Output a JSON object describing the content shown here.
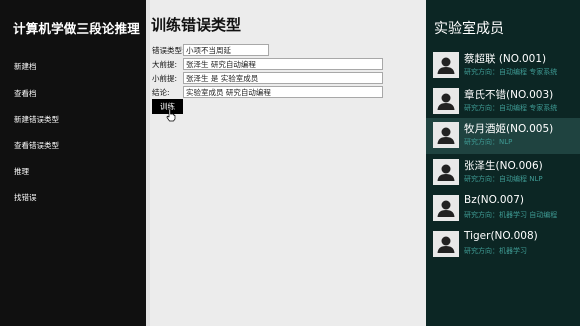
{
  "sidebar": {
    "app_title": "计算机学做三段论推理",
    "items": [
      {
        "label": "新建档"
      },
      {
        "label": "查看档"
      },
      {
        "label": "新建错误类型"
      },
      {
        "label": "查看错误类型"
      },
      {
        "label": "推理"
      },
      {
        "label": "找错误"
      }
    ]
  },
  "main": {
    "title": "训练错误类型",
    "fields": [
      {
        "label": "错误类型:",
        "value": "小项不当周延"
      },
      {
        "label": "大前提:",
        "value": "张泽生 研究自动编程"
      },
      {
        "label": "小前提:",
        "value": "张泽生 是 实验室成员"
      },
      {
        "label": "结论:",
        "value": "实验室成员 研究自动编程"
      }
    ],
    "train_button": "训练"
  },
  "members": {
    "title": "实验室成员",
    "list": [
      {
        "name": "蔡超联 (NO.001)",
        "direction": "研究方向：自动编程 专家系统",
        "active": false
      },
      {
        "name": "章氏不错(NO.003)",
        "direction": "研究方向：自动编程 专家系统",
        "active": false
      },
      {
        "name": "牧月酒姬(NO.005)",
        "direction": "研究方向：NLP",
        "active": true
      },
      {
        "name": "张泽生(NO.006)",
        "direction": "研究方向：自动编程  NLP",
        "active": false
      },
      {
        "name": "Bz(NO.007)",
        "direction": "研究方向：机器学习 自动编程",
        "active": false
      },
      {
        "name": "Tiger(NO.008)",
        "direction": "研究方向：机器学习",
        "active": false
      }
    ]
  },
  "colors": {
    "sidebar_bg": "#101010",
    "members_bg": "#0c2624",
    "members_active_bg": "#1f4340",
    "direction_text": "#3e9a93"
  },
  "icons": {
    "avatar": "user-silhouette-icon",
    "cursor": "hand-pointer-icon"
  }
}
